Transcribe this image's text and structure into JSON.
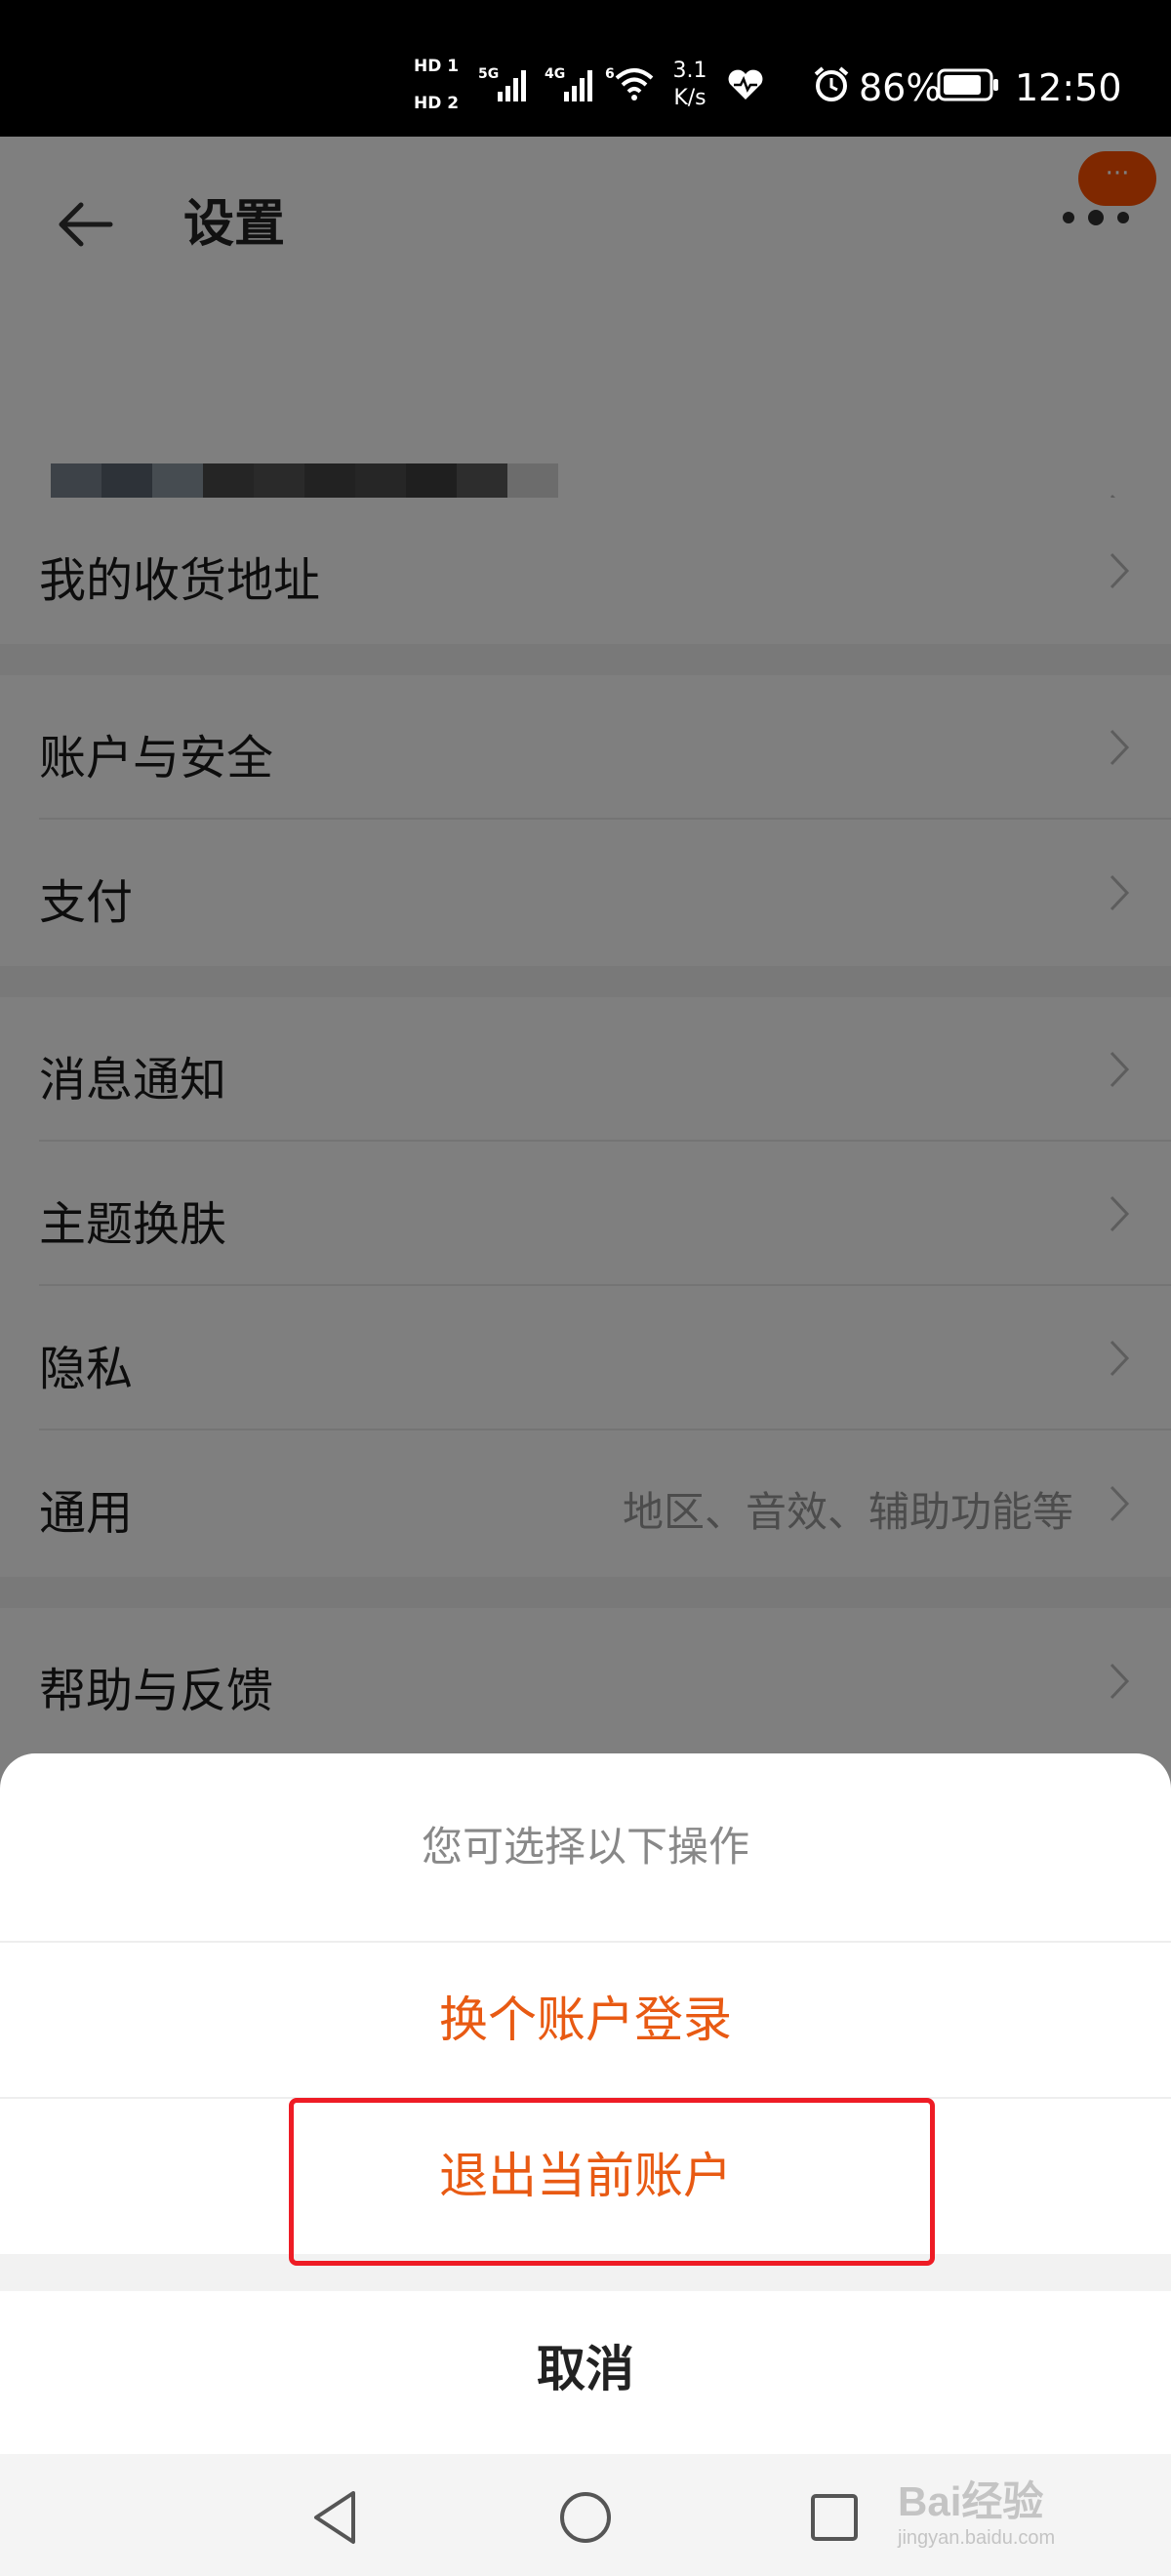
{
  "status_bar": {
    "hd1": "HD 1",
    "hd2": "HD 2",
    "net1": "5G",
    "net2": "4G",
    "wifi_tx": "6",
    "speed_value": "3.1",
    "speed_unit": "K/s",
    "battery": "86%",
    "time": "12:50"
  },
  "nav": {
    "title": "设置",
    "badge": "···"
  },
  "settings": {
    "address": "我的收货地址",
    "account_security": "账户与安全",
    "payment": "支付",
    "notifications": "消息通知",
    "theme": "主题换肤",
    "privacy": "隐私",
    "general": "通用",
    "general_hint": "地区、音效、辅助功能等",
    "help": "帮助与反馈"
  },
  "sheet": {
    "title": "您可选择以下操作",
    "switch_account": "换个账户登录",
    "logout": "退出当前账户",
    "cancel": "取消"
  },
  "watermark": {
    "main": "Bai经验",
    "sub": "jingyan.baidu.com"
  },
  "colors": {
    "accent": "#e85a13",
    "highlight": "#ee1c25",
    "badge": "#ff5000"
  }
}
